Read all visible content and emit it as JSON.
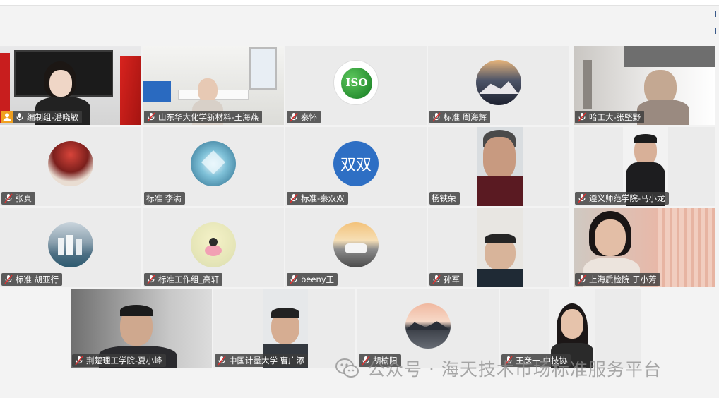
{
  "participants": [
    {
      "name": "编制组-潘晓敏",
      "is_host": true
    },
    {
      "name": "山东华大化学新材料-王海燕"
    },
    {
      "name": "秦怀",
      "avatar_text": "ISO"
    },
    {
      "name": "标准  周海辉"
    },
    {
      "name": "哈工大-张堅野"
    },
    {
      "name": "张真"
    },
    {
      "name": "标准   李满",
      "mic_hidden": true
    },
    {
      "name": "标准-秦双双",
      "avatar_text": "双双"
    },
    {
      "name": "杨铁荣",
      "mic_hidden": true
    },
    {
      "name": "遵义师范学院-马小龙"
    },
    {
      "name": "标准 胡亚行"
    },
    {
      "name": "标准工作组_高轩"
    },
    {
      "name": "beeny王"
    },
    {
      "name": "孙军"
    },
    {
      "name": "上海质检院 于小芳"
    },
    {
      "name": "荆楚理工学院-夏小峰"
    },
    {
      "name": "中国计量大学    曹广添"
    },
    {
      "name": "胡榆阳"
    },
    {
      "name": "王彦一-中技协"
    }
  ],
  "watermark": {
    "text": "公众号 · 海天技术市场标准服务平台"
  },
  "colors": {
    "tile_bg": "#ebebeb",
    "label_bg": "#3c3c3c",
    "host_badge": "#f0a020",
    "double_avatar": "#2e6fc4"
  },
  "icons": {
    "mic": "mic-muted-icon",
    "host": "host-user-icon",
    "watermark": "wechat-icon"
  }
}
